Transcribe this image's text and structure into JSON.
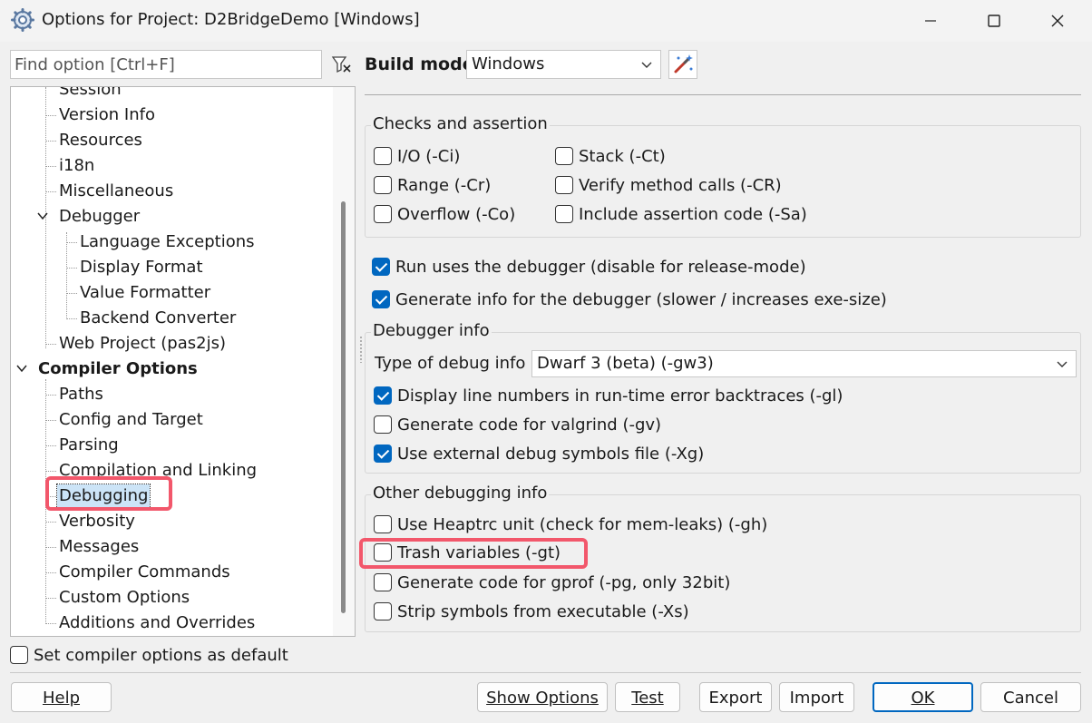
{
  "window": {
    "title": "Options for Project: D2BridgeDemo [Windows]"
  },
  "search": {
    "placeholder": "Find option [Ctrl+F]"
  },
  "tree": {
    "items": [
      {
        "label": "Session"
      },
      {
        "label": "Version Info"
      },
      {
        "label": "Resources"
      },
      {
        "label": "i18n"
      },
      {
        "label": "Miscellaneous"
      },
      {
        "label": "Debugger"
      },
      {
        "label": "Language Exceptions"
      },
      {
        "label": "Display Format"
      },
      {
        "label": "Value Formatter"
      },
      {
        "label": "Backend Converter"
      },
      {
        "label": "Web Project (pas2js)"
      },
      {
        "label": "Compiler Options"
      },
      {
        "label": "Paths"
      },
      {
        "label": "Config and Target"
      },
      {
        "label": "Parsing"
      },
      {
        "label": "Compilation and Linking"
      },
      {
        "label": "Debugging"
      },
      {
        "label": "Verbosity"
      },
      {
        "label": "Messages"
      },
      {
        "label": "Compiler Commands"
      },
      {
        "label": "Custom Options"
      },
      {
        "label": "Additions and Overrides"
      }
    ]
  },
  "build_mode": {
    "label": "Build mode",
    "value": "Windows"
  },
  "checks": {
    "title": "Checks and assertion",
    "io": {
      "label": "I/O (-Ci)",
      "checked": false
    },
    "range": {
      "label": "Range (-Cr)",
      "checked": false
    },
    "overflow": {
      "label": "Overflow (-Co)",
      "checked": false
    },
    "stack": {
      "label": "Stack (-Ct)",
      "checked": false
    },
    "verify": {
      "label": "Verify method calls (-CR)",
      "checked": false
    },
    "assert": {
      "label": "Include assertion code (-Sa)",
      "checked": false
    }
  },
  "run_debugger": {
    "label": "Run uses the debugger (disable for release-mode)",
    "checked": true
  },
  "gen_info": {
    "label": "Generate info for the debugger (slower / increases exe-size)",
    "checked": true
  },
  "debugger_info": {
    "title": "Debugger info",
    "type_label": "Type of debug info",
    "type_value": "Dwarf 3 (beta) (-gw3)",
    "line_numbers": {
      "label": "Display line numbers in run-time error backtraces (-gl)",
      "checked": true
    },
    "valgrind": {
      "label": "Generate code for valgrind (-gv)",
      "checked": false
    },
    "external": {
      "label": "Use external debug symbols file (-Xg)",
      "checked": true
    }
  },
  "other_info": {
    "title": "Other debugging info",
    "heaptrc": {
      "label": "Use Heaptrc unit (check for mem-leaks) (-gh)",
      "checked": false
    },
    "trash": {
      "label": "Trash variables (-gt)",
      "checked": false
    },
    "gprof": {
      "label": "Generate code for gprof (-pg, only 32bit)",
      "checked": false
    },
    "strip": {
      "label": "Strip symbols from executable (-Xs)",
      "checked": false
    }
  },
  "default_cb": {
    "label": "Set compiler options as default",
    "checked": false
  },
  "buttons": {
    "help": "Help",
    "show_options": "Show Options",
    "test": "Test",
    "export": "Export",
    "import": "Import",
    "ok": "OK",
    "cancel": "Cancel"
  },
  "colors": {
    "accent": "#0067c0",
    "highlight": "#f2576b",
    "selection": "#cce4f7"
  }
}
